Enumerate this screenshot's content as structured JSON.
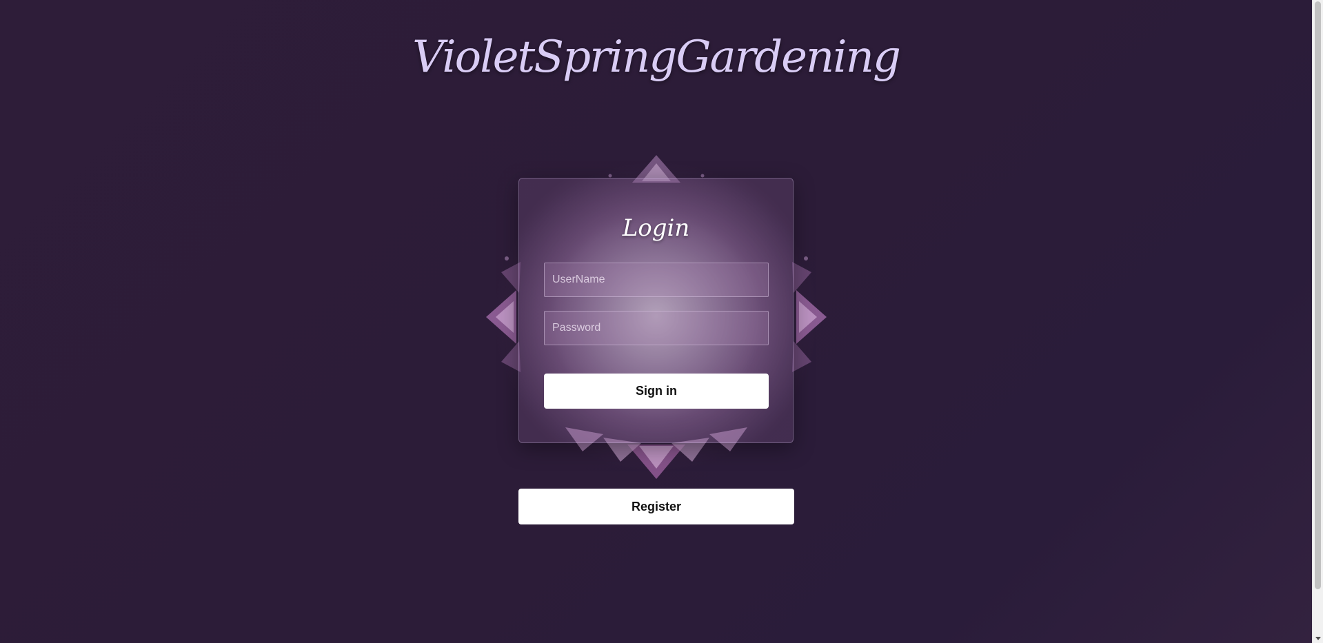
{
  "site": {
    "title": "VioletSpringGardening"
  },
  "login": {
    "heading": "Login",
    "username_placeholder": "UserName",
    "username_value": "",
    "password_placeholder": "Password",
    "password_value": "",
    "signin_label": "Sign in"
  },
  "register": {
    "label": "Register"
  },
  "colors": {
    "background": "#2c1c38",
    "title": "#d9ccf5",
    "button": "#ffffff",
    "button_text": "#111111"
  },
  "icons": {
    "mandala": "mandala-ornament"
  }
}
